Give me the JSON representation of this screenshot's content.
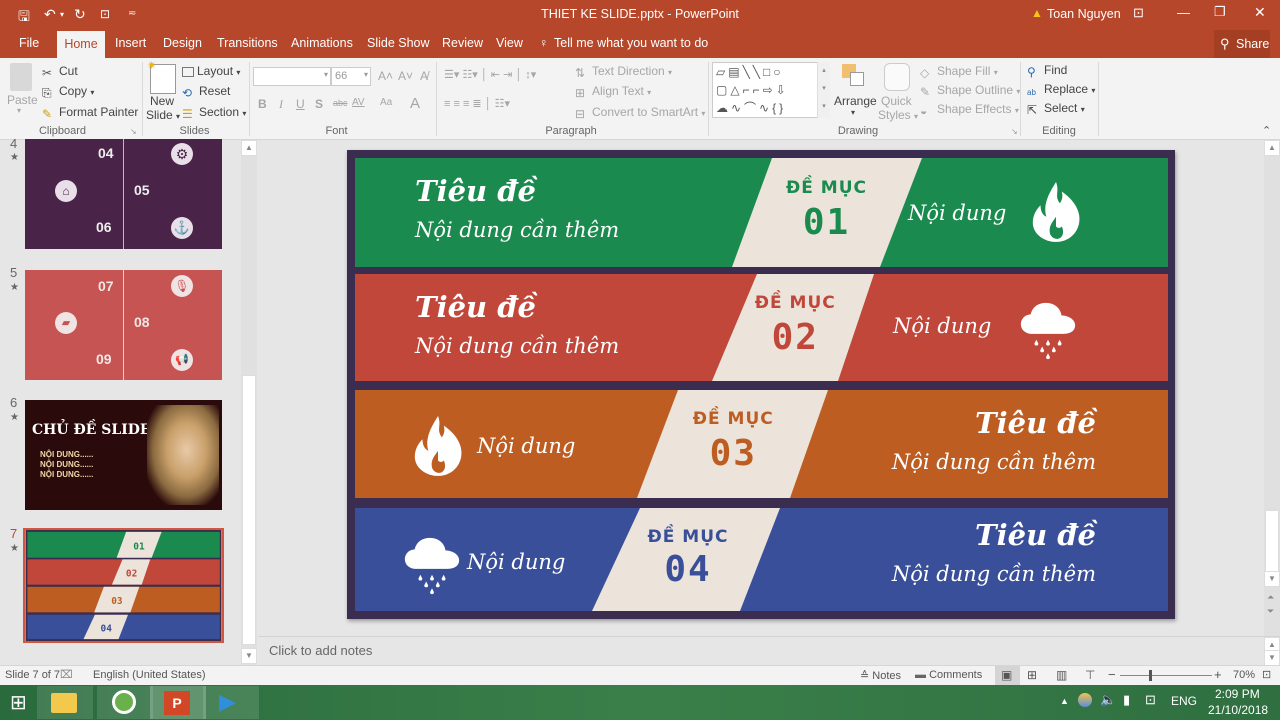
{
  "window": {
    "title": "THIET KE SLIDE.pptx - PowerPoint",
    "user": "Toan Nguyen",
    "share_label": "Share"
  },
  "tabs": [
    "File",
    "Home",
    "Insert",
    "Design",
    "Transitions",
    "Animations",
    "Slide Show",
    "Review",
    "View"
  ],
  "tell_me": "Tell me what you want to do",
  "ribbon": {
    "clipboard": {
      "paste": "Paste",
      "cut": "Cut",
      "copy": "Copy",
      "format_painter": "Format Painter",
      "group": "Clipboard"
    },
    "slides": {
      "new_slide_1": "New",
      "new_slide_2": "Slide",
      "layout": "Layout",
      "reset": "Reset",
      "section": "Section",
      "group": "Slides"
    },
    "font": {
      "font_name": "",
      "font_size": "66",
      "bold": "B",
      "italic": "I",
      "underline": "U",
      "shadow": "S",
      "strike": "abc",
      "spacing": "AV",
      "case": "Aa",
      "group": "Font"
    },
    "paragraph": {
      "text_direction": "Text Direction",
      "align_text": "Align Text",
      "convert_smartart": "Convert to SmartArt",
      "group": "Paragraph"
    },
    "drawing": {
      "arrange": "Arrange",
      "quick_styles_1": "Quick",
      "quick_styles_2": "Styles",
      "shape_fill": "Shape Fill",
      "shape_outline": "Shape Outline",
      "shape_effects": "Shape Effects",
      "group": "Drawing"
    },
    "editing": {
      "find": "Find",
      "replace": "Replace",
      "select": "Select",
      "group": "Editing"
    }
  },
  "thumbnails": [
    {
      "number": "4",
      "labels": [
        "04",
        "05",
        "06"
      ]
    },
    {
      "number": "5",
      "labels": [
        "07",
        "08",
        "09"
      ]
    },
    {
      "number": "6",
      "title": "CHỦ ĐỀ SLIDE",
      "lines": [
        "NỘI DUNG......",
        "NỘI DUNG......",
        "NỘI DUNG......"
      ]
    },
    {
      "number": "7",
      "selected": true
    }
  ],
  "slide": {
    "frame_color": "#3b2d4f",
    "strip_color": "#ece4da",
    "bands": [
      {
        "color": "#1b8a4f",
        "title": "Tiêu đề",
        "content": "Nội dung cần thêm",
        "heading": "ĐỀ MỤC",
        "number": "01",
        "side_text": "Nội dung",
        "icon": "fire-icon",
        "layout": "text-left"
      },
      {
        "color": "#c0473a",
        "title": "Tiêu đề",
        "content": "Nội dung cần thêm",
        "heading": "ĐỀ MỤC",
        "number": "02",
        "side_text": "Nội dung",
        "icon": "rain-cloud-icon",
        "layout": "text-left"
      },
      {
        "color": "#bd5d22",
        "title": "Tiêu đề",
        "content": "Nội dung cần thêm",
        "heading": "ĐỀ MỤC",
        "number": "03",
        "side_text": "Nội dung",
        "icon": "fire-icon",
        "layout": "text-right"
      },
      {
        "color": "#3a4f9a",
        "title": "Tiêu đề",
        "content": "Nội dung cần thêm",
        "heading": "ĐỀ MỤC",
        "number": "04",
        "side_text": "Nội dung",
        "icon": "rain-cloud-icon",
        "layout": "text-right"
      }
    ]
  },
  "notes_placeholder": "Click to add notes",
  "status": {
    "slide_info": "Slide 7 of 7",
    "language": "English (United States)",
    "notes": "Notes",
    "comments": "Comments",
    "zoom": "70%"
  },
  "taskbar": {
    "time": "2:09 PM",
    "date": "21/10/2018",
    "lang": "ENG"
  }
}
